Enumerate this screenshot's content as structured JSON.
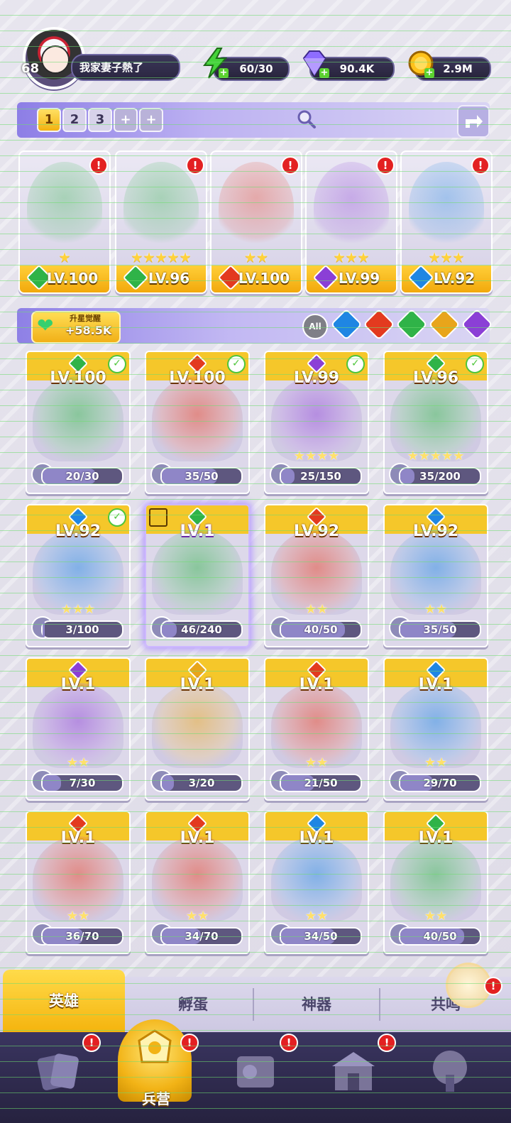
{
  "player": {
    "level": "68",
    "name": "我家妻子熱了"
  },
  "resources": [
    {
      "icon": "energy-bolt-icon",
      "value": "60/30",
      "color": "#45d33b"
    },
    {
      "icon": "diamond-gem-icon",
      "value": "90.4K",
      "color": "#8e6cff"
    },
    {
      "icon": "gold-coin-icon",
      "value": "2.9M",
      "color": "#ffc21b"
    }
  ],
  "team_tabs": [
    "1",
    "2",
    "3",
    "+",
    "+"
  ],
  "team": [
    {
      "level": "LV.100",
      "stars": 1,
      "element": "nature",
      "alert": "!"
    },
    {
      "level": "LV.96",
      "stars": 5,
      "element": "nature",
      "alert": "!"
    },
    {
      "level": "LV.100",
      "stars": 2,
      "element": "fire",
      "alert": "!"
    },
    {
      "level": "LV.99",
      "stars": 3,
      "element": "dark",
      "alert": "!"
    },
    {
      "level": "LV.92",
      "stars": 3,
      "element": "water",
      "alert": "!"
    }
  ],
  "awaken": {
    "label": "升星觉醒",
    "value": "+58.5K"
  },
  "filters": {
    "all_label": "All",
    "elements": [
      "water",
      "fire",
      "nature",
      "light",
      "dark"
    ]
  },
  "element_colors": {
    "nature": "#2fb348",
    "fire": "#e33a1f",
    "water": "#1f86e3",
    "dark": "#8b3fd6",
    "light": "#e8a51b"
  },
  "heroes": [
    {
      "level": "LV.100",
      "element": "nature",
      "stars": 0,
      "shards": "20/30",
      "fill": 0.67,
      "owned": true
    },
    {
      "level": "LV.100",
      "element": "fire",
      "stars": 0,
      "shards": "35/50",
      "fill": 0.7,
      "owned": true
    },
    {
      "level": "LV.99",
      "element": "dark",
      "stars": 4,
      "shards": "25/150",
      "fill": 0.17,
      "owned": true
    },
    {
      "level": "LV.96",
      "element": "nature",
      "stars": 5,
      "shards": "35/200",
      "fill": 0.18,
      "owned": true
    },
    {
      "level": "LV.92",
      "element": "water",
      "stars": 3,
      "shards": "3/100",
      "fill": 0.03,
      "owned": true
    },
    {
      "level": "LV.1",
      "element": "nature",
      "stars": 0,
      "shards": "46/240",
      "fill": 0.19,
      "owned": false,
      "selected": true
    },
    {
      "level": "LV.92",
      "element": "fire",
      "stars": 2,
      "shards": "40/50",
      "fill": 0.8,
      "owned": false
    },
    {
      "level": "LV.92",
      "element": "water",
      "stars": 2,
      "shards": "35/50",
      "fill": 0.7,
      "owned": false
    },
    {
      "level": "LV.1",
      "element": "dark",
      "stars": 2,
      "shards": "7/30",
      "fill": 0.23,
      "owned": false
    },
    {
      "level": "LV.1",
      "element": "light",
      "stars": 0,
      "shards": "3/20",
      "fill": 0.15,
      "owned": false
    },
    {
      "level": "LV.1",
      "element": "fire",
      "stars": 2,
      "shards": "21/50",
      "fill": 0.42,
      "owned": false
    },
    {
      "level": "LV.1",
      "element": "water",
      "stars": 2,
      "shards": "29/70",
      "fill": 0.41,
      "owned": false
    },
    {
      "level": "LV.1",
      "element": "fire",
      "stars": 2,
      "shards": "36/70",
      "fill": 0.51,
      "owned": false
    },
    {
      "level": "LV.1",
      "element": "fire",
      "stars": 2,
      "shards": "34/70",
      "fill": 0.49,
      "owned": false
    },
    {
      "level": "LV.1",
      "element": "water",
      "stars": 2,
      "shards": "34/50",
      "fill": 0.68,
      "owned": false
    },
    {
      "level": "LV.1",
      "element": "nature",
      "stars": 2,
      "shards": "40/50",
      "fill": 0.8,
      "owned": false
    }
  ],
  "subtabs": [
    "英雄",
    "孵蛋",
    "神器",
    "共鸣"
  ],
  "bottom_nav": {
    "active_label": "兵营",
    "items": [
      "cards-icon",
      "barracks-icon",
      "scroll-map-icon",
      "gate-icon",
      "tree-icon"
    ]
  }
}
